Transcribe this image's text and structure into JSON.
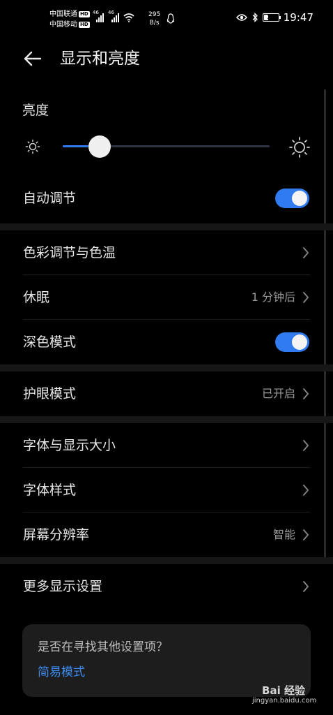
{
  "status_bar": {
    "carrier1": "中国联通",
    "carrier2": "中国移动",
    "hd_badge": "HD",
    "network_tag1": "46",
    "network_tag2": "46",
    "net_speed_value": "295",
    "net_speed_unit": "B/s",
    "battery_level": "39",
    "battery_percent": 39,
    "time": "19:47",
    "icons": [
      "signal-icon",
      "wifi-icon",
      "qq-icon",
      "eye-icon",
      "bluetooth-icon",
      "battery-icon"
    ]
  },
  "header": {
    "title": "显示和亮度",
    "back_icon": "back-arrow-icon"
  },
  "brightness": {
    "label": "亮度",
    "level_fraction": 0.18,
    "min_icon": "sun-small-icon",
    "max_icon": "sun-large-icon"
  },
  "rows": {
    "auto_adjust": {
      "label": "自动调节",
      "toggle_on": true
    },
    "color_temp": {
      "label": "色彩调节与色温"
    },
    "sleep": {
      "label": "休眠",
      "value": "1 分钟后"
    },
    "dark_mode": {
      "label": "深色模式",
      "toggle_on": true
    },
    "eye_comfort": {
      "label": "护眼模式",
      "value": "已开启"
    },
    "font_size": {
      "label": "字体与显示大小"
    },
    "font_style": {
      "label": "字体样式"
    },
    "resolution": {
      "label": "屏幕分辨率",
      "value": "智能"
    },
    "more_display": {
      "label": "更多显示设置"
    }
  },
  "card": {
    "question": "是否在寻找其他设置项？",
    "link": "简易模式"
  },
  "watermark": {
    "brand": "Bai 经验",
    "domain": "jingyan.baidu.com"
  },
  "colors": {
    "accent": "#2f7bef",
    "background": "#000000",
    "text": "#e6e6e6",
    "secondary_text": "#9a9a9a",
    "link": "#3b8bf0"
  }
}
